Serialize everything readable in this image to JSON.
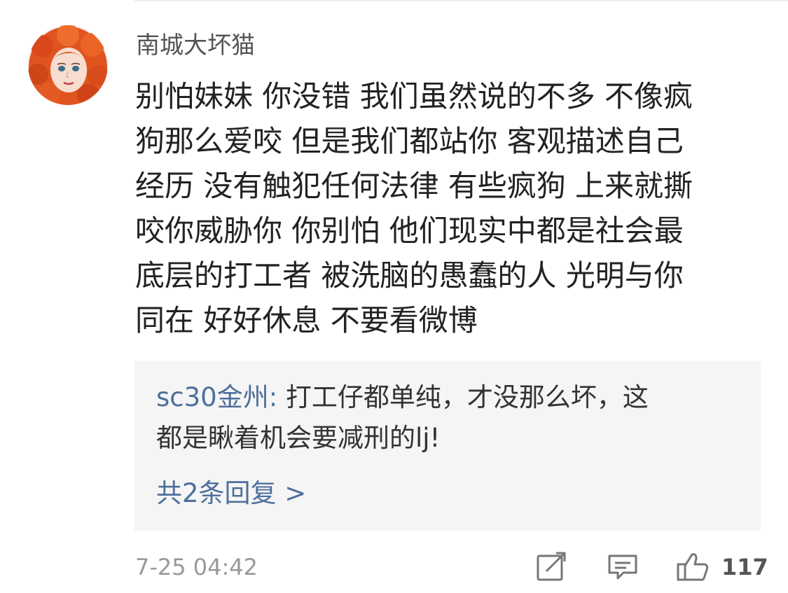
{
  "comment": {
    "username": "南城大坏猫",
    "avatar_icon": "cartoon-red-haired-girl-avatar",
    "body_lines": [
      "别怕妹妹 你没错 我们虽然说的不多 不像疯",
      "狗那么爱咬 但是我们都站你 客观描述自己",
      "经历 没有触犯任何法律 有些疯狗 上来就撕",
      "咬你威胁你 你别怕 他们现实中都是社会最",
      "底层的打工者 被洗脑的愚蠢的人 光明与你",
      "同在 好好休息 不要看微博"
    ],
    "timestamp": "7-25 04:42",
    "like_count": "117"
  },
  "reply": {
    "username": "sc30金州",
    "separator": ": ",
    "text_first": "打工仔都单纯，才没那么坏，这",
    "text_second": "都是瞅着机会要减刑的lj!",
    "total_replies_label": "共2条回复 >"
  },
  "actions": {
    "share_icon": "share-icon",
    "comment_icon": "comment-icon",
    "like_icon": "thumbs-up-icon"
  },
  "colors": {
    "link_blue": "#4e6f9c",
    "reply_background": "#f5f5f5",
    "text_primary": "#222222",
    "text_muted": "#999999"
  }
}
